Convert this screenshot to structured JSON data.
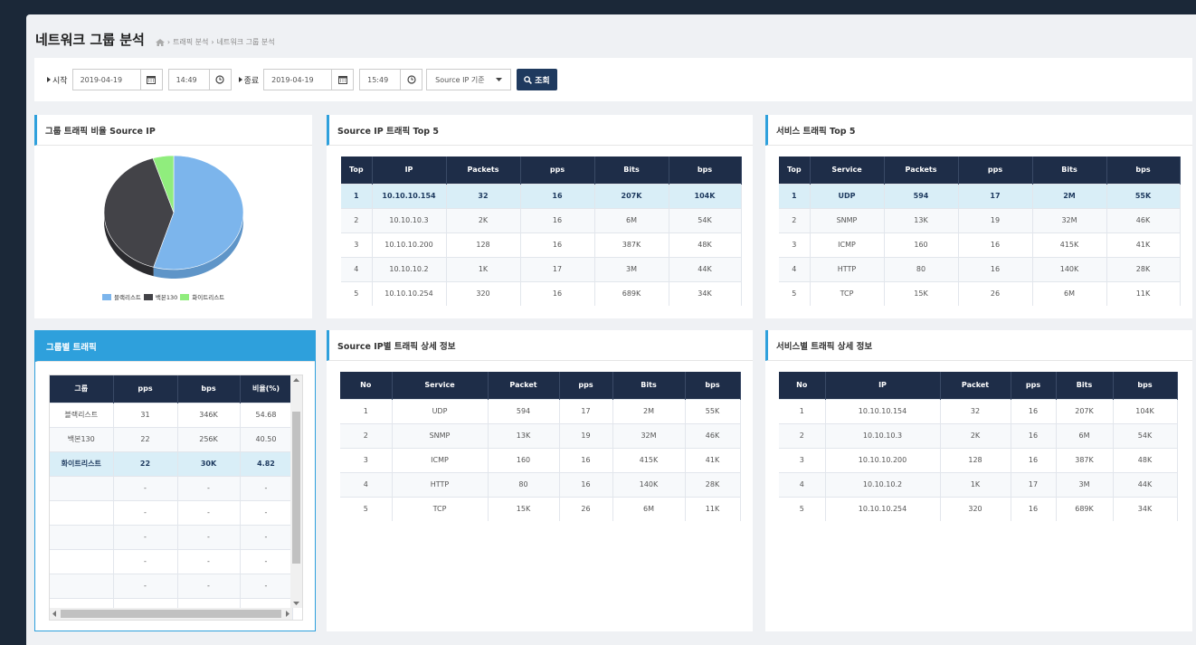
{
  "page": {
    "title": "네트워크 그룹 분석",
    "breadcrumb": [
      "트래픽 분석",
      "네트워크 그룹 분석"
    ]
  },
  "filters": {
    "start_label": "시작",
    "start_date": "2019-04-19",
    "start_time": "14:49",
    "end_label": "종료",
    "end_date": "2019-04-19",
    "end_time": "15:49",
    "basis_select": "Source IP 기준",
    "search_button": "조회"
  },
  "pie_panel": {
    "title": "그룹 트래픽 비율 Source IP",
    "colors": {
      "blacklist": "#7cb5ec",
      "backbone": "#434348",
      "whitelist": "#90ed7d"
    },
    "legend": [
      "블랙리스트",
      "백본130",
      "화이트리스트"
    ],
    "chart_data": {
      "type": "pie",
      "categories": [
        "블랙리스트",
        "백본130",
        "화이트리스트"
      ],
      "values": [
        54.68,
        40.5,
        4.82
      ]
    }
  },
  "src_top5": {
    "title": "Source IP 트래픽 Top 5",
    "headers": [
      "Top",
      "IP",
      "Packets",
      "pps",
      "Bits",
      "bps"
    ],
    "rows": [
      [
        "1",
        "10.10.10.154",
        "32",
        "16",
        "207K",
        "104K"
      ],
      [
        "2",
        "10.10.10.3",
        "2K",
        "16",
        "6M",
        "54K"
      ],
      [
        "3",
        "10.10.10.200",
        "128",
        "16",
        "387K",
        "48K"
      ],
      [
        "4",
        "10.10.10.2",
        "1K",
        "17",
        "3M",
        "44K"
      ],
      [
        "5",
        "10.10.10.254",
        "320",
        "16",
        "689K",
        "34K"
      ]
    ]
  },
  "svc_top5": {
    "title": "서비스 트래픽 Top 5",
    "headers": [
      "Top",
      "Service",
      "Packets",
      "pps",
      "Bits",
      "bps"
    ],
    "rows": [
      [
        "1",
        "UDP",
        "594",
        "17",
        "2M",
        "55K"
      ],
      [
        "2",
        "SNMP",
        "13K",
        "19",
        "32M",
        "46K"
      ],
      [
        "3",
        "ICMP",
        "160",
        "16",
        "415K",
        "41K"
      ],
      [
        "4",
        "HTTP",
        "80",
        "16",
        "140K",
        "28K"
      ],
      [
        "5",
        "TCP",
        "15K",
        "26",
        "6M",
        "11K"
      ]
    ]
  },
  "group_panel": {
    "title": "그룹별 트래픽",
    "headers": [
      "그룹",
      "pps",
      "bps",
      "비율(%)"
    ],
    "rows": [
      [
        "블랙리스트",
        "31",
        "346K",
        "54.68"
      ],
      [
        "백본130",
        "22",
        "256K",
        "40.50"
      ],
      [
        "화이트리스트",
        "22",
        "30K",
        "4.82"
      ],
      [
        "",
        "-",
        "-",
        "-"
      ],
      [
        "",
        "-",
        "-",
        "-"
      ],
      [
        "",
        "-",
        "-",
        "-"
      ],
      [
        "",
        "-",
        "-",
        "-"
      ],
      [
        "",
        "-",
        "-",
        "-"
      ],
      [
        "",
        "",
        "",
        ""
      ]
    ]
  },
  "src_detail": {
    "title": "Source IP별 트래픽 상세 정보",
    "headers": [
      "No",
      "Service",
      "Packet",
      "pps",
      "Bits",
      "bps"
    ],
    "rows": [
      [
        "1",
        "UDP",
        "594",
        "17",
        "2M",
        "55K"
      ],
      [
        "2",
        "SNMP",
        "13K",
        "19",
        "32M",
        "46K"
      ],
      [
        "3",
        "ICMP",
        "160",
        "16",
        "415K",
        "41K"
      ],
      [
        "4",
        "HTTP",
        "80",
        "16",
        "140K",
        "28K"
      ],
      [
        "5",
        "TCP",
        "15K",
        "26",
        "6M",
        "11K"
      ]
    ]
  },
  "svc_detail": {
    "title": "서비스별 트래픽 상세 정보",
    "headers": [
      "No",
      "IP",
      "Packet",
      "pps",
      "Bits",
      "bps"
    ],
    "rows": [
      [
        "1",
        "10.10.10.154",
        "32",
        "16",
        "207K",
        "104K"
      ],
      [
        "2",
        "10.10.10.3",
        "2K",
        "16",
        "6M",
        "54K"
      ],
      [
        "3",
        "10.10.10.200",
        "128",
        "16",
        "387K",
        "48K"
      ],
      [
        "4",
        "10.10.10.2",
        "1K",
        "17",
        "3M",
        "44K"
      ],
      [
        "5",
        "10.10.10.254",
        "320",
        "16",
        "689K",
        "34K"
      ]
    ]
  }
}
